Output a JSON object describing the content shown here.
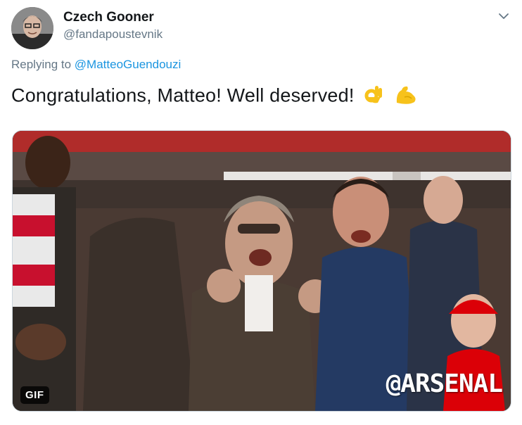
{
  "author": {
    "name": "Czech Gooner",
    "handle": "@fandapoustevnik"
  },
  "reply": {
    "prefix": "Replying to",
    "mention": "@MatteoGuendouzi"
  },
  "tweet": {
    "text": "Congratulations, Matteo! Well deserved!",
    "emojis": [
      "ok-hand-emoji",
      "flexed-biceps-emoji"
    ]
  },
  "media": {
    "badge": "GIF",
    "watermark": "@ARSENAL"
  },
  "icons": {
    "menu": "chevron-down-icon"
  },
  "colors": {
    "link": "#1b95e0",
    "secondary_text": "#657786",
    "primary_text": "#14171a",
    "arsenal_red": "#db0007"
  }
}
